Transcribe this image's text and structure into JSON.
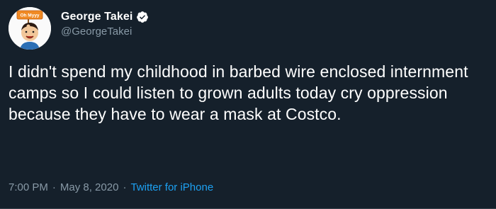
{
  "author": {
    "display_name": "George Takei",
    "handle": "@GeorgeTakei",
    "verified": true,
    "avatar_sign_text": "Oh Myyy"
  },
  "tweet": {
    "text": "I didn't spend my childhood in barbed wire enclosed internment camps so I could listen to grown adults today cry oppression because they have to wear a mask at Costco."
  },
  "meta": {
    "time": "7:00 PM",
    "separator": "·",
    "date": "May 8, 2020",
    "source": "Twitter for iPhone"
  },
  "colors": {
    "background": "#15202b",
    "text": "#ffffff",
    "secondary_text": "#8899a6",
    "link": "#1da1f2",
    "verified_badge": "#ffffff"
  },
  "icons": {
    "verified": "verified-badge-icon",
    "avatar": "cartoon-avatar-with-oh-myyy-sign"
  }
}
